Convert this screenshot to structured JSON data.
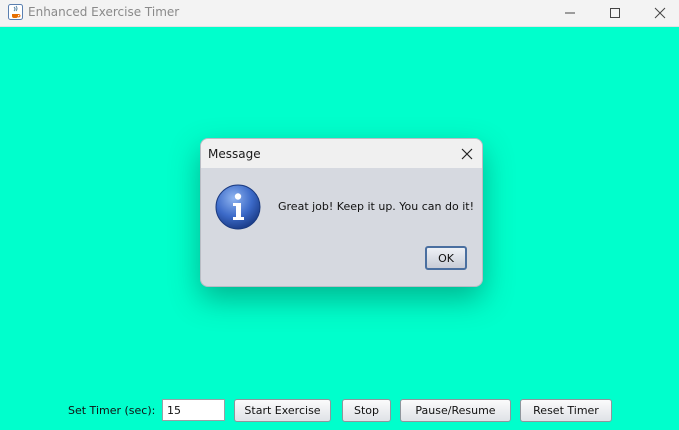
{
  "window": {
    "title": "Enhanced Exercise Timer",
    "icon": "java-cup-icon",
    "controls": [
      "minimize-icon",
      "maximize-icon",
      "close-icon"
    ]
  },
  "colors": {
    "background": "#00ffcc",
    "dialog_body": "#d6d9e0",
    "dialog_titlebar": "#f0f0f0",
    "ok_border": "#4a6fa0"
  },
  "dialog": {
    "title": "Message",
    "icon": "info-icon",
    "message": "Great job! Keep it up. You can do it!",
    "ok_label": "OK"
  },
  "controls": {
    "timer_label": "Set Timer (sec):",
    "timer_value": "15",
    "start_label": "Start Exercise",
    "stop_label": "Stop",
    "pause_label": "Pause/Resume",
    "reset_label": "Reset Timer"
  }
}
